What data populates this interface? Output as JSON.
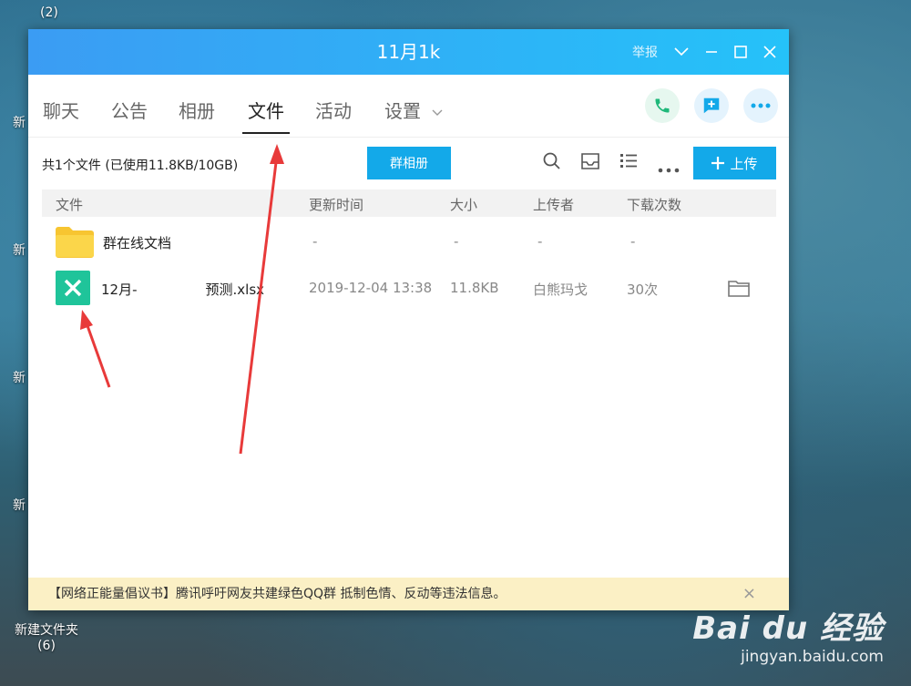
{
  "desktop": {
    "top_label_count": "(2)",
    "side_labels": [
      "新",
      "新",
      "新",
      "新"
    ],
    "bottom_label": "新建文件夹",
    "bottom_label_count": "(6)"
  },
  "window": {
    "title": "11月1k",
    "report_label": "举报",
    "tabs": [
      "聊天",
      "公告",
      "相册",
      "文件",
      "活动",
      "设置"
    ],
    "active_tab": "文件"
  },
  "toolbar": {
    "summary": "共1个文件 (已使用11.8KB/10GB)",
    "album_button": "群相册",
    "upload_button": "上传"
  },
  "table": {
    "headers": [
      "文件",
      "更新时间",
      "大小",
      "上传者",
      "下载次数"
    ],
    "rows": [
      {
        "name": "群在线文档",
        "time": "-",
        "size": "-",
        "uploader": "-",
        "downloads": "-",
        "icon": "folder-icon"
      },
      {
        "name": "12月-　　　　　预测.xlsx",
        "time": "2019-12-04 13:38",
        "size": "11.8KB",
        "uploader": "白熊玛戈",
        "downloads": "30次",
        "icon": "excel-icon"
      }
    ]
  },
  "notice": {
    "text": "【网络正能量倡议书】腾讯呼吁网友共建绿色QQ群 抵制色情、反动等违法信息。",
    "close": "×"
  },
  "watermark": {
    "brand": "Bai du 经验",
    "url": "jingyan.baidu.com"
  },
  "colors": {
    "accent": "#13a9e9",
    "title_gradient_start": "#3b9cf3",
    "title_gradient_end": "#25c2f9",
    "notice_bg": "#fbf0c5",
    "arrow": "#e83a3a"
  }
}
